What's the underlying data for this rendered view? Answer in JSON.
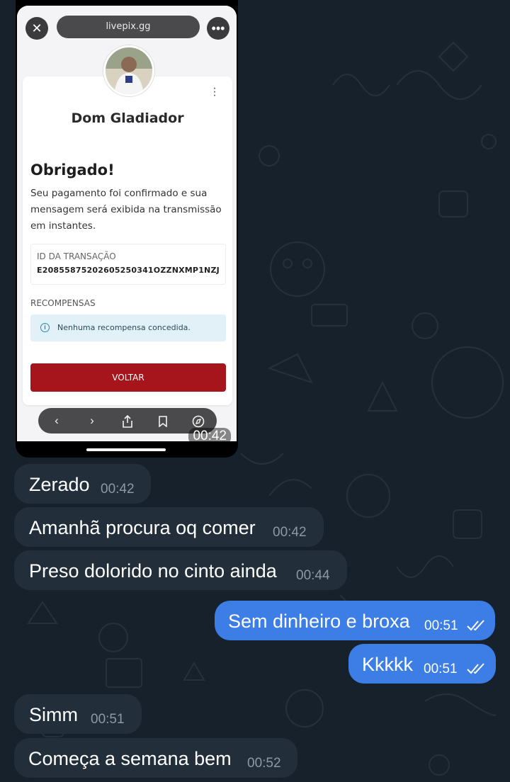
{
  "screenshot": {
    "url": "livepix.gg",
    "profile_name": "Dom Gladiador",
    "heading": "Obrigado!",
    "message": "Seu pagamento foi confirmado e sua mensagem será exibida na transmissão em instantes.",
    "transaction_label": "ID DA TRANSAÇÃO",
    "transaction_id": "E20855875202605250341OZZNXMP1NZJ",
    "rewards_label": "RECOMPENSAS",
    "rewards_info": "Nenhuma recompensa concedida.",
    "button_label": "VOLTAR",
    "time": "00:42"
  },
  "messages": [
    {
      "text": "Zerado",
      "time": "00:42",
      "direction": "incoming"
    },
    {
      "text": "Amanhã procura oq comer",
      "time": "00:42",
      "direction": "incoming"
    },
    {
      "text": "Preso dolorido no cinto ainda",
      "time": "00:44",
      "direction": "incoming"
    },
    {
      "text": "Sem dinheiro e broxa",
      "time": "00:51",
      "direction": "outgoing",
      "status": "read"
    },
    {
      "text": "Kkkkk",
      "time": "00:51",
      "direction": "outgoing",
      "status": "read"
    },
    {
      "text": "Simm",
      "time": "00:51",
      "direction": "incoming"
    },
    {
      "text": "Começa a semana bem",
      "time": "00:52",
      "direction": "incoming"
    }
  ],
  "colors": {
    "background": "#16212c",
    "incoming_bubble": "#222e3a",
    "outgoing_bubble": "#3d7ee6",
    "voltar_button": "#a7151c"
  }
}
